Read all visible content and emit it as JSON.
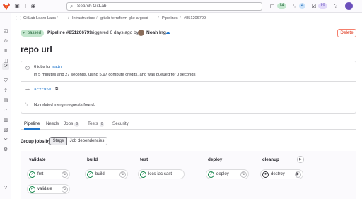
{
  "topbar": {
    "search_placeholder": "Search GitLab",
    "issues_count": "14",
    "mr_count": "4",
    "todo_count": "19",
    "colors": {
      "issues": "#c3e6cd",
      "mr": "#cbe2f9",
      "todo": "#e1d8f9"
    }
  },
  "breadcrumb": {
    "items": [
      "GitLab Learn Labs",
      "Infrastructure",
      "gitlab-terraform-gke-argocd",
      "Pipelines",
      "#851206799"
    ]
  },
  "header": {
    "status": "passed",
    "pipeline_label": "Pipeline #851206799",
    "triggered_text": "triggered 6 days ago by",
    "user_name": "Noah Ing",
    "delete_label": "Delete"
  },
  "title": "repo url",
  "info": {
    "jobs_text": "6 jobs for",
    "branch": "main",
    "duration_text": "in 5 minutes and 27 seconds, using 5.97 compute credits, and was queued for 0 seconds",
    "commit_sha": "ac2f95e",
    "mr_text": "No related merge requests found."
  },
  "tabs": [
    {
      "label": "Pipeline",
      "count": null
    },
    {
      "label": "Needs",
      "count": null
    },
    {
      "label": "Jobs",
      "count": "6"
    },
    {
      "label": "Tests",
      "count": "0"
    },
    {
      "label": "Security",
      "count": null
    }
  ],
  "group_by": {
    "label": "Group jobs by",
    "options": [
      "Stage",
      "Job dependencies"
    ],
    "selected": "Stage"
  },
  "stages": [
    {
      "name": "validate",
      "jobs": [
        {
          "name": "fmt",
          "status": "passed"
        },
        {
          "name": "validate",
          "status": "passed"
        }
      ]
    },
    {
      "name": "build",
      "jobs": [
        {
          "name": "build",
          "status": "passed"
        }
      ]
    },
    {
      "name": "test",
      "jobs": [
        {
          "name": "kics-iac-sast",
          "status": "passed"
        }
      ]
    },
    {
      "name": "deploy",
      "jobs": [
        {
          "name": "deploy",
          "status": "passed"
        }
      ]
    },
    {
      "name": "cleanup",
      "jobs": [
        {
          "name": "destroy",
          "status": "manual"
        }
      ]
    }
  ]
}
